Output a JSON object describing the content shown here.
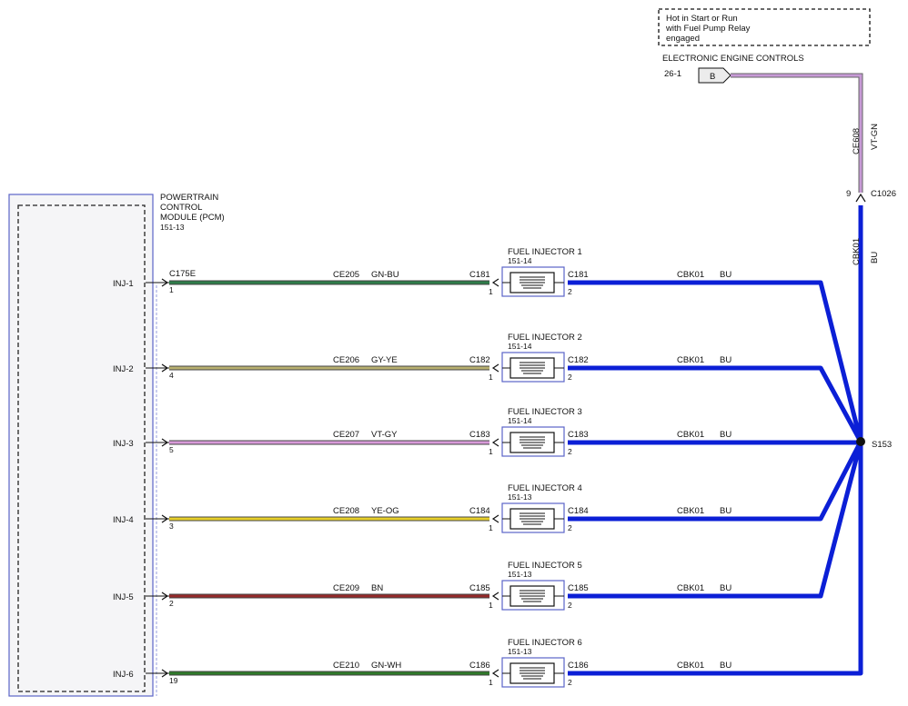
{
  "note": {
    "lines": [
      "Hot in Start or Run",
      "with Fuel Pump Relay",
      "engaged"
    ]
  },
  "source": {
    "title": "ELECTRONIC ENGINE CONTROLS",
    "ref": "26-1",
    "pin": "B",
    "feed_circuit": "CE608",
    "feed_color": "VT-GN",
    "feed_color_hex": "#c79ad6",
    "connector_pin": "9",
    "connector": "C1026",
    "vertical_circuit": "CBK01",
    "vertical_color": "BU"
  },
  "module": {
    "lines": [
      "POWERTRAIN",
      "CONTROL",
      "MODULE (PCM)",
      "151-13"
    ],
    "connector": "C175E"
  },
  "splice": "S153",
  "colors": {
    "BU": "#0b1fd6",
    "outline": "#5b63c8"
  },
  "circuits": [
    {
      "inj": "INJ-1",
      "pin": "1",
      "circuit": "CE205",
      "color": "GN-BU",
      "hex": "#2e7c4a",
      "conn": "C181",
      "injector": "FUEL INJECTOR 1",
      "ref": "151-14",
      "out_conn": "C181",
      "out_circuit": "CBK01",
      "out_color": "BU"
    },
    {
      "inj": "INJ-2",
      "pin": "4",
      "circuit": "CE206",
      "color": "GY-YE",
      "hex": "#b8b070",
      "conn": "C182",
      "injector": "FUEL INJECTOR 2",
      "ref": "151-14",
      "out_conn": "C182",
      "out_circuit": "CBK01",
      "out_color": "BU"
    },
    {
      "inj": "INJ-3",
      "pin": "5",
      "circuit": "CE207",
      "color": "VT-GY",
      "hex": "#d79ad8",
      "conn": "C183",
      "injector": "FUEL INJECTOR 3",
      "ref": "151-14",
      "out_conn": "C183",
      "out_circuit": "CBK01",
      "out_color": "BU"
    },
    {
      "inj": "INJ-4",
      "pin": "3",
      "circuit": "CE208",
      "color": "YE-OG",
      "hex": "#e7cf2a",
      "conn": "C184",
      "injector": "FUEL INJECTOR 4",
      "ref": "151-13",
      "out_conn": "C184",
      "out_circuit": "CBK01",
      "out_color": "BU"
    },
    {
      "inj": "INJ-5",
      "pin": "2",
      "circuit": "CE209",
      "color": "BN",
      "hex": "#952a2a",
      "conn": "C185",
      "injector": "FUEL INJECTOR 5",
      "ref": "151-13",
      "out_conn": "C185",
      "out_circuit": "CBK01",
      "out_color": "BU"
    },
    {
      "inj": "INJ-6",
      "pin": "19",
      "circuit": "CE210",
      "color": "GN-WH",
      "hex": "#2f7a2a",
      "conn": "C186",
      "injector": "FUEL INJECTOR 6",
      "ref": "151-13",
      "out_conn": "C186",
      "out_circuit": "CBK01",
      "out_color": "BU"
    }
  ]
}
